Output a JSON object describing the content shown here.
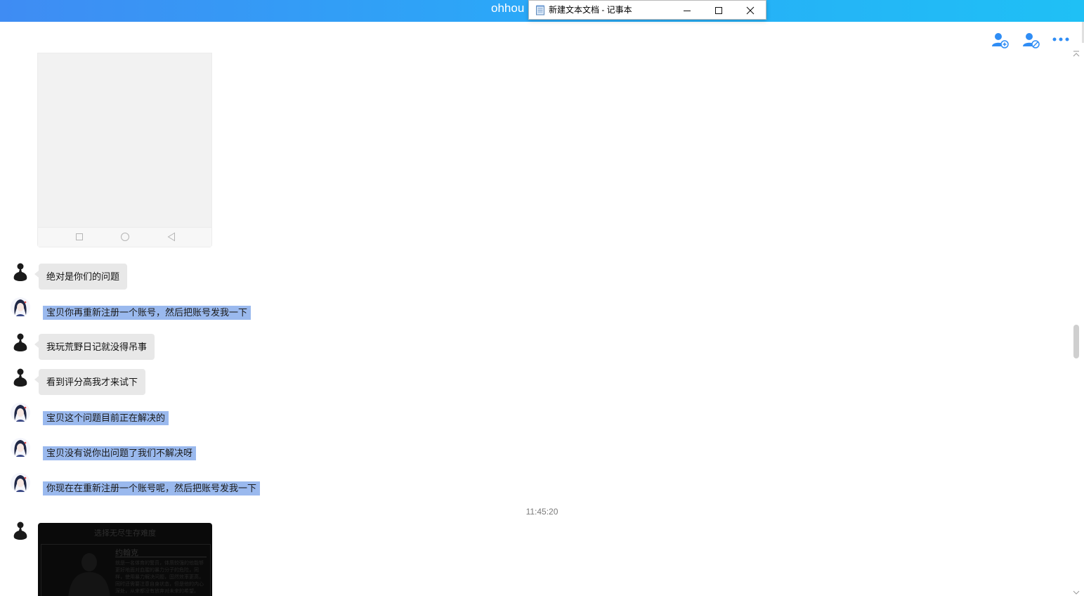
{
  "app": {
    "title": "ohhou"
  },
  "notepad": {
    "title": "新建文本文档 - 记事本",
    "minimize": "minimize-icon",
    "maximize": "maximize-icon",
    "close": "close-icon"
  },
  "header_icons": [
    "add-user-icon",
    "block-user-icon",
    "more-icon"
  ],
  "messages": [
    {
      "from": "customer",
      "text": "绝对是你们的问题"
    },
    {
      "from": "agent",
      "text": "宝贝你再重新注册一个账号，然后把账号发我一下"
    },
    {
      "from": "customer",
      "text": "我玩荒野日记就没得吊事"
    },
    {
      "from": "customer",
      "text": "看到评分高我才来试下"
    },
    {
      "from": "agent",
      "text": "宝贝这个问题目前正在解决的"
    },
    {
      "from": "agent",
      "text": "宝贝没有说你出问题了我们不解决呀"
    },
    {
      "from": "agent",
      "text": "你现在在重新注册一个账号呢，然后把账号发我一下"
    }
  ],
  "timestamp": "11:45:20",
  "game_image": {
    "title": "选择无尽生存难度",
    "name": "约翰克",
    "desc": "就是一名体育的警员，体质较强的他能够更好地面对血腥的暴力分子的危险，同样，使用暴力解决问题，固然效率更高，同时还需要注意自身状态，但是他的内心深处，从来都没有放弃对未来的希望。"
  },
  "colors": {
    "titlebar_start": "#3f8cf3",
    "titlebar_end": "#1fc0f5",
    "selection": "#9ab9ee",
    "bubble": "#e8e8e8",
    "icon_blue": "#2f8df5"
  }
}
